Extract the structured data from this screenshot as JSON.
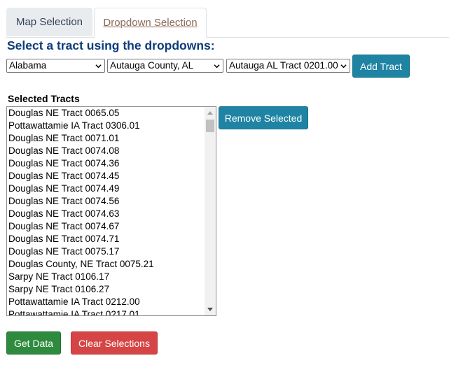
{
  "tabs": [
    {
      "label": "Map Selection",
      "active": false
    },
    {
      "label": "Dropdown Selection",
      "active": true
    }
  ],
  "heading": "Select a tract using the dropdowns:",
  "dropdowns": {
    "state": "Alabama",
    "county": "Autauga County, AL",
    "tract": "Autauga AL Tract 0201.00"
  },
  "buttons": {
    "add_tract": "Add Tract",
    "remove_selected": "Remove Selected",
    "get_data": "Get Data",
    "clear_selections": "Clear Selections"
  },
  "selected_label": "Selected Tracts",
  "selected_tracts": [
    "Douglas NE Tract 0065.05",
    "Pottawattamie IA Tract 0306.01",
    "Douglas NE Tract 0071.01",
    "Douglas NE Tract 0074.08",
    "Douglas NE Tract 0074.36",
    "Douglas NE Tract 0074.45",
    "Douglas NE Tract 0074.49",
    "Douglas NE Tract 0074.56",
    "Douglas NE Tract 0074.63",
    "Douglas NE Tract 0074.67",
    "Douglas NE Tract 0074.71",
    "Douglas NE Tract 0075.17",
    "Douglas County, NE Tract 0075.21",
    "Sarpy NE Tract 0106.17",
    "Sarpy NE Tract 0106.27",
    "Pottawattamie IA Tract 0212.00",
    "Pottawattamie IA Tract 0217.01"
  ],
  "icons": {
    "dropdown_caret": "chevron-down-icon",
    "scroll_up": "triangle-up-icon",
    "scroll_down": "triangle-down-icon"
  },
  "colors": {
    "heading": "#0d3b7a",
    "teal_button": "#1f84a3",
    "green_button": "#2e8b3e",
    "red_button": "#d64545"
  }
}
